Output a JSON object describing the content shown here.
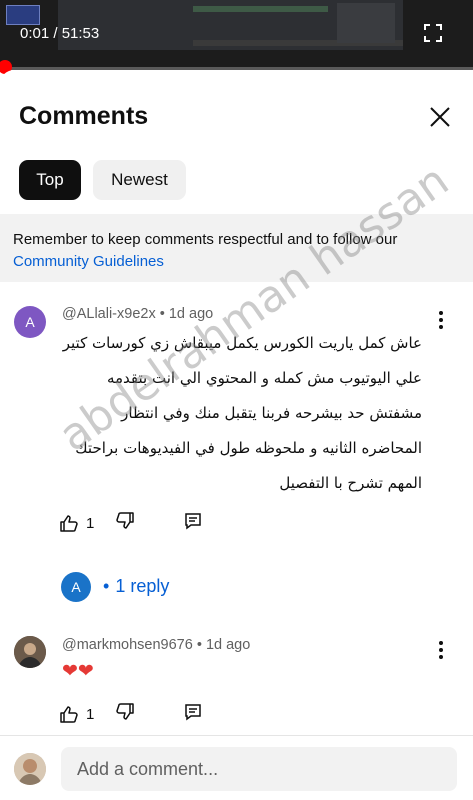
{
  "video": {
    "time": "0:01 / 51:53",
    "progress_fraction": 0.0002
  },
  "header": {
    "title": "Comments"
  },
  "sort": {
    "top_label": "Top",
    "newest_label": "Newest"
  },
  "notice": {
    "text": "Remember to keep comments respectful and to follow our",
    "link": "Community Guidelines"
  },
  "comments": [
    {
      "author": "@ALlali-x9e2x",
      "age": "1d ago",
      "avatar_letter": "A",
      "text": "عاش كمل ياريت الكورس يكمل ميبقاش زي كورسات كتير علي اليوتيوب مش كمله و المحتوي الي انت بتقدمه مشفتش حد بيشرحه فربنا يتقبل منك وفي انتظار المحاضره الثانيه و ملحوظه طول في الفيديوهات براحتك المهم تشرح با التفصيل",
      "likes": "1",
      "reply_avatar_letter": "A",
      "reply_label": "1 reply"
    },
    {
      "author": "@markmohsen9676",
      "age": "1d ago",
      "text": "❤❤",
      "likes": "1"
    }
  ],
  "composer": {
    "placeholder": "Add a comment..."
  },
  "watermark": "abdelrahman hassan",
  "colors": {
    "accent_link": "#065fd4",
    "progress": "#ff0000",
    "chip_active": "#0f0f0f"
  }
}
